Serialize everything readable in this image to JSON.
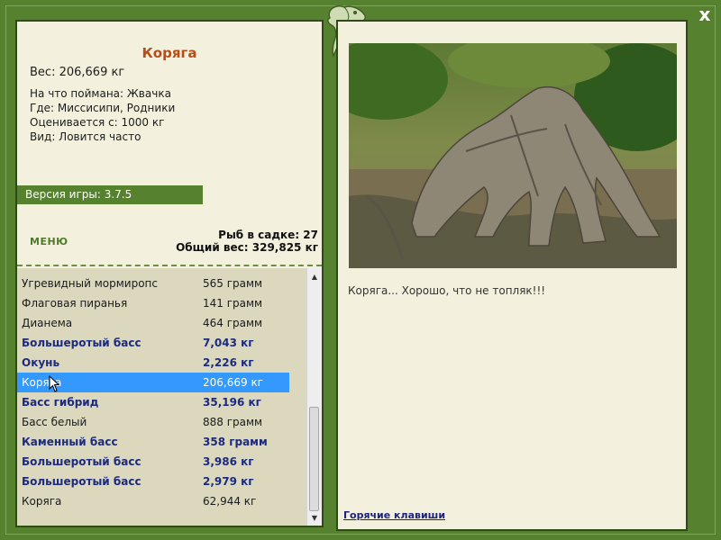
{
  "window": {
    "close_label": "x"
  },
  "fish": {
    "title": "Коряга",
    "weight": "Вес: 206,669 кг",
    "caught_on": "На что поймана: Жвачка",
    "where": "Где: Миссисипи, Родники",
    "valued_from": "Оценивается с: 1000 кг",
    "kind": "Вид: Ловится часто"
  },
  "version": "Версия игры: 3.7.5",
  "menu_label": "МЕНЮ",
  "stats": {
    "fish_count": "Рыб в садке: 27",
    "total_weight": "Общий вес: 329,825 кг"
  },
  "catch_list": [
    {
      "name": "Угревидный мормиропс",
      "weight": "565 грамм",
      "bold": false,
      "selected": false
    },
    {
      "name": "Флаговая пиранья",
      "weight": "141 грамм",
      "bold": false,
      "selected": false
    },
    {
      "name": "Дианема",
      "weight": "464 грамм",
      "bold": false,
      "selected": false
    },
    {
      "name": "Большеротый басс",
      "weight": "7,043 кг",
      "bold": true,
      "selected": false
    },
    {
      "name": "Окунь",
      "weight": "2,226 кг",
      "bold": true,
      "selected": false
    },
    {
      "name": "Коряга",
      "weight": "206,669 кг",
      "bold": false,
      "selected": true
    },
    {
      "name": "Басс гибрид",
      "weight": "35,196 кг",
      "bold": true,
      "selected": false
    },
    {
      "name": "Басс белый",
      "weight": "888 грамм",
      "bold": false,
      "selected": false
    },
    {
      "name": "Каменный басс",
      "weight": "358 грамм",
      "bold": true,
      "selected": false
    },
    {
      "name": "Большеротый басс",
      "weight": "3,986 кг",
      "bold": true,
      "selected": false
    },
    {
      "name": "Большеротый басс",
      "weight": "2,979 кг",
      "bold": true,
      "selected": false
    },
    {
      "name": "Коряга",
      "weight": "62,944 кг",
      "bold": false,
      "selected": false
    }
  ],
  "photo": {
    "icon": "driftwood-photo"
  },
  "caption": "Коряга... Хорошо, что не топляк!!!",
  "hotkeys_label": "Горячие клавиши",
  "colors": {
    "frame": "#56822f",
    "panel": "#f3f0dd",
    "list_bg": "#dbd8bd",
    "title": "#b84e17",
    "selected": "#3399ff",
    "bold_item": "#1c2a80"
  }
}
